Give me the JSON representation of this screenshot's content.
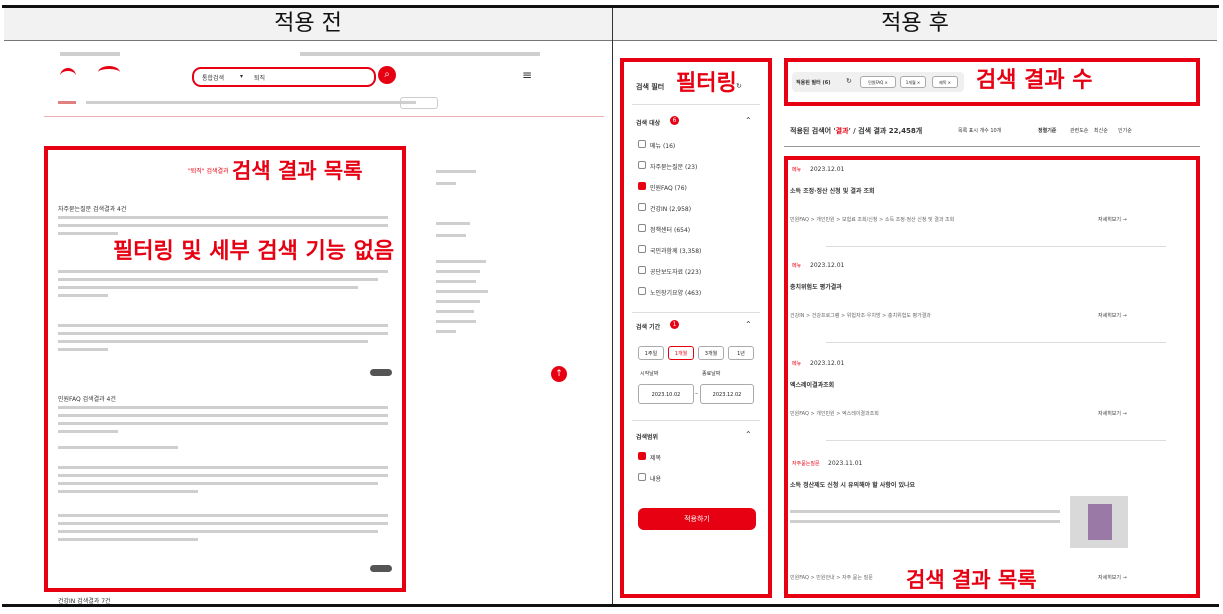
{
  "headers": {
    "before": "적용 전",
    "after": "적용 후"
  },
  "before_panel": {
    "results_label": "검색 결과 목록",
    "no_filter_label": "필터링 및 세부 검색 기능 없음",
    "search_select": "통합검색",
    "search_value": "퇴직",
    "result_header": "\"퇴직\" 검색결과",
    "section_1": "자주묻는질문 검색결과 4건",
    "section_2": "민원FAQ 검색결과 4건",
    "footer_text": "건강IN 검색결과 7건"
  },
  "filter_panel": {
    "title_overlay": "필터링",
    "filter_title": "검색 필터",
    "target": {
      "title": "검색 대상",
      "count": "6",
      "items": [
        {
          "label": "메뉴 (16)",
          "checked": false
        },
        {
          "label": "자주묻는질문 (23)",
          "checked": false
        },
        {
          "label": "민원FAQ (76)",
          "checked": true
        },
        {
          "label": "건강IN (2,958)",
          "checked": false
        },
        {
          "label": "정책센터 (654)",
          "checked": false
        },
        {
          "label": "국민과함께 (3,358)",
          "checked": false
        },
        {
          "label": "공단보도자료 (223)",
          "checked": false
        },
        {
          "label": "노인장기요양 (463)",
          "checked": false
        }
      ]
    },
    "period": {
      "title": "검색 기간",
      "count": "1",
      "buttons": [
        "1주일",
        "1개월",
        "3개월",
        "1년"
      ],
      "active": "1개월",
      "start_label": "시작날짜",
      "end_label": "종료날짜",
      "start": "2023.10.02",
      "end": "2023.12.02"
    },
    "scope": {
      "title": "검색범위",
      "items": [
        {
          "label": "제목",
          "checked": true
        },
        {
          "label": "내용",
          "checked": false
        }
      ]
    },
    "apply_label": "적용하기"
  },
  "after_panel": {
    "count_overlay": "검색 결과 수",
    "results_overlay": "검색 결과 목록",
    "applied_filter": "적용된 필터 (6)",
    "chips": [
      "민원FAQ ×",
      "1개월 ×",
      "제목 ×"
    ],
    "summary_prefix": "적용된 검색어 '",
    "summary_keyword": "결과",
    "summary_suffix": "' / 검색 결과 22,458개",
    "per_page": "목록 표시 개수 10개",
    "sort_label": "정렬기준",
    "sort_options": [
      "관련도순",
      "최신순",
      "인기순"
    ],
    "more_label": "자세히보기 →",
    "items": [
      {
        "tag": "메뉴",
        "date": "2023.12.01",
        "title": "소득 조정·정산 신청 및 결과 조회",
        "path": "민원FAQ > 개인민원 > 보험료 조회/신청 > 소득 조정·정산 신청 및 결과 조회"
      },
      {
        "tag": "메뉴",
        "date": "2023.12.01",
        "title": "충치위험도 평가결과",
        "path": "건강IN > 건강프로그램 > 위험자조·우치방 > 충치위험도 평가결과"
      },
      {
        "tag": "메뉴",
        "date": "2023.12.01",
        "title": "엑스레이결과조회",
        "path": "민원FAQ > 개인민원 > 엑스레이결과조회"
      },
      {
        "tag": "자주묻는질문",
        "date": "2023.11.01",
        "title": "소득 정산제도 신청 시 유의해야 할 사항이 있나요",
        "path": "민원FAQ > 민원안내 > 자주 묻는 질문"
      }
    ]
  }
}
